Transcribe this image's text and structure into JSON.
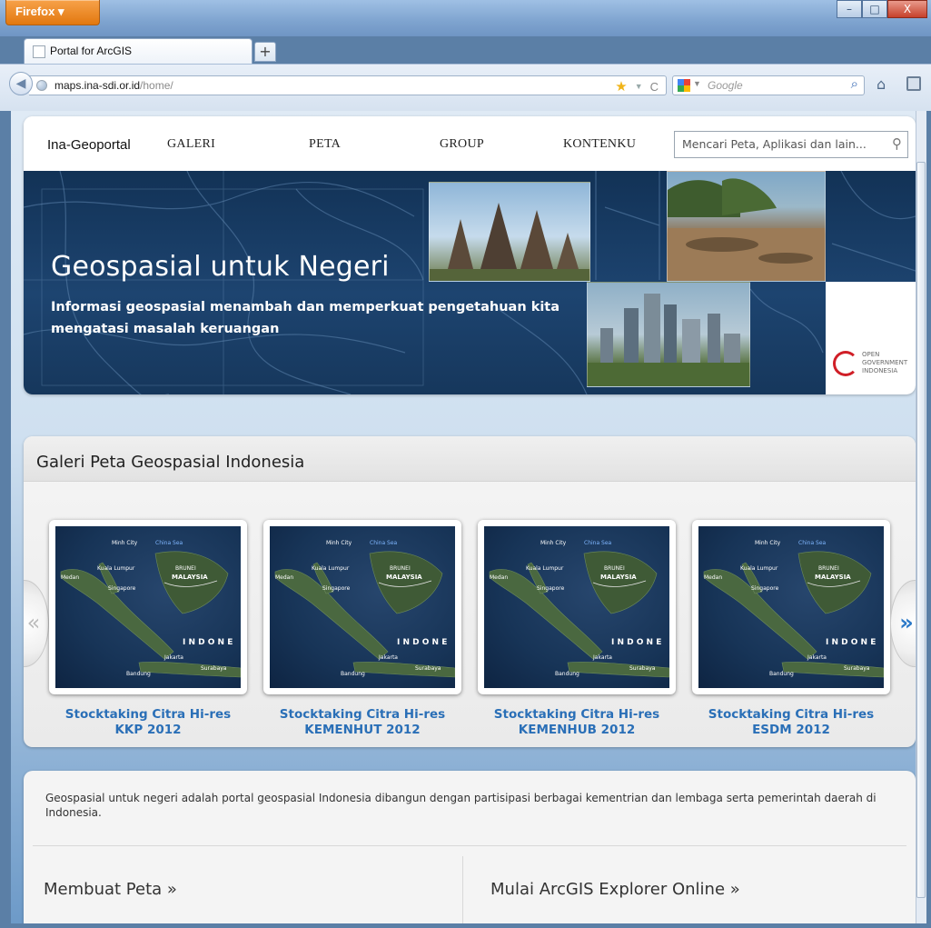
{
  "browser": {
    "app_button": "Firefox ▾",
    "tab_title": "Portal for ArcGIS",
    "new_tab": "+",
    "url_host": "maps.ina-sdi.or.id",
    "url_path": "/home/",
    "search_engine": "Google",
    "window_controls": {
      "minimize": "–",
      "maximize": "□",
      "close": "X"
    }
  },
  "nav": {
    "brand": "Ina-Geoportal",
    "items": [
      {
        "label": "GALERI"
      },
      {
        "label": "PETA"
      },
      {
        "label": "GROUP"
      },
      {
        "label": "KONTENKU"
      }
    ],
    "search_placeholder": "Mencari Peta, Aplikasi dan lain..."
  },
  "banner": {
    "title": "Geospasial untuk Negeri",
    "subtitle_line1": "Informasi geospasial menambah dan memperkuat pengetahuan kita",
    "subtitle_line2": "mengatasi masalah keruangan",
    "logo_lines": [
      "OPEN",
      "GOVERNMENT",
      "INDONESIA"
    ]
  },
  "gallery": {
    "title": "Galeri Peta Geospasial Indonesia",
    "prev_label": "«",
    "next_label": "»",
    "items": [
      {
        "line1": "Stocktaking Citra Hi-res",
        "line2": "KKP 2012"
      },
      {
        "line1": "Stocktaking Citra Hi-res",
        "line2": "KEMENHUT 2012"
      },
      {
        "line1": "Stocktaking Citra Hi-res",
        "line2": "KEMENHUB 2012"
      },
      {
        "line1": "Stocktaking Citra Hi-res",
        "line2": "ESDM 2012"
      }
    ],
    "map_labels": {
      "city1": "Minh City",
      "sea": "China Sea",
      "kl": "Kuala Lumpur",
      "brunei": "BRUNEI",
      "malaysia": "MALAYSIA",
      "medan": "Medan",
      "singapore": "Singapore",
      "indonesia": "I N D O N E",
      "jakarta": "Jakarta",
      "surabaya": "Surabaya",
      "bandung": "Bandung"
    }
  },
  "info": {
    "description": "Geospasial untuk negeri adalah portal geospasial Indonesia dibangun dengan partisipasi berbagai kementrian dan lembaga serta pemerintah daerah di Indonesia.",
    "link_left": "Membuat Peta »",
    "link_right": "Mulai ArcGIS Explorer Online »"
  }
}
